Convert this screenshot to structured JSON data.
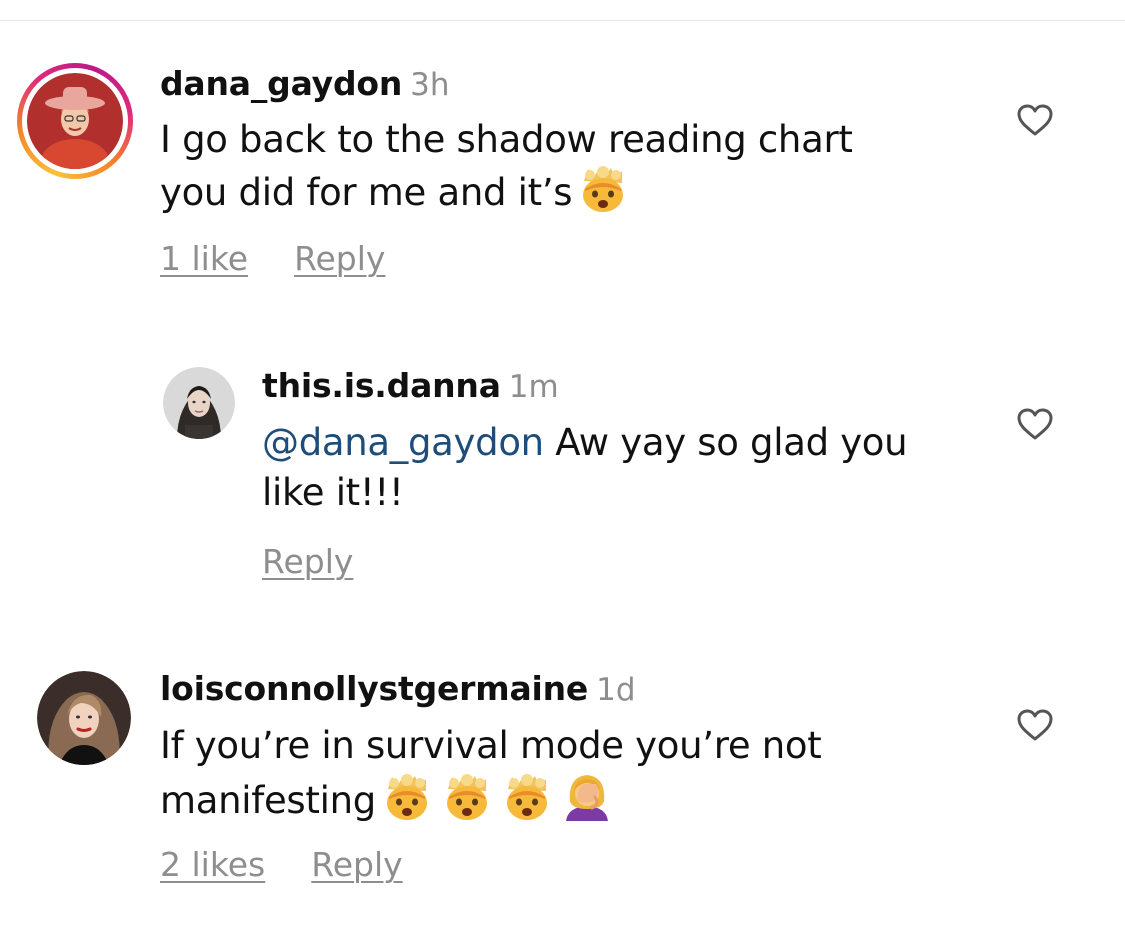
{
  "comments": [
    {
      "username": "dana_gaydon",
      "time": "3h",
      "text": "I go back to the shadow reading chart you did for me and it’s",
      "emojis": [
        "exploding-head"
      ],
      "likes": "1 like",
      "reply": "Reply",
      "avatar": {
        "has_story_ring": true,
        "bg": "#c73a32"
      }
    },
    {
      "username": "this.is.danna",
      "time": "1m",
      "mention": "@dana_gaydon",
      "text": " Aw yay so glad you like it!!!",
      "reply": "Reply",
      "avatar": {
        "has_story_ring": false,
        "bg": "#d9d9d9"
      }
    },
    {
      "username": "loisconnollystgermaine",
      "time": "1d",
      "text": "If you’re in survival mode you’re not manifesting",
      "emojis": [
        "exploding-head",
        "exploding-head",
        "exploding-head",
        "face-palm"
      ],
      "likes": "2 likes",
      "reply": "Reply",
      "avatar": {
        "has_story_ring": false,
        "bg": "#3b2e2a"
      }
    }
  ],
  "colors": {
    "text": "#111111",
    "secondary": "#8e8e8e",
    "mention": "#1f4d7a",
    "heart_stroke": "#555555"
  }
}
